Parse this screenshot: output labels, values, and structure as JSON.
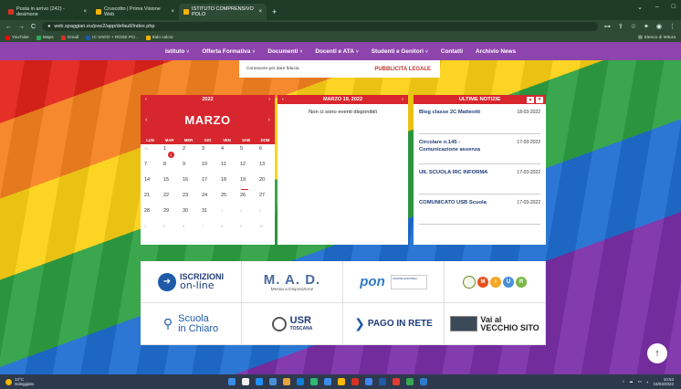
{
  "browser": {
    "tabs": [
      {
        "label": "Posta in arrivo (242) - desimone",
        "color": "#d93025"
      },
      {
        "label": "Cruscotto | Prima Visione Web",
        "color": "#f4b400"
      },
      {
        "label": "ISTITUTO COMPRENSIVO POLO",
        "color": "#f4b400"
      }
    ],
    "new_tab": "+",
    "url": "web.spaggiari.eu/pvw2/app/default/index.php",
    "bookmarks": [
      {
        "label": "YouTube",
        "color": "#ff0000"
      },
      {
        "label": "Maps",
        "color": "#34a853"
      },
      {
        "label": "Gmail",
        "color": "#d93025"
      },
      {
        "label": "IC VADO + ROSE PO...",
        "color": "#1e5aa8"
      },
      {
        "label": "Italo calcio",
        "color": "#f4b400"
      }
    ],
    "bookmarks_right": "Elenco di lettura"
  },
  "nav": {
    "items": [
      {
        "label": "Istituto",
        "caret": true
      },
      {
        "label": "Offerta Formativa",
        "caret": true
      },
      {
        "label": "Documenti",
        "caret": true
      },
      {
        "label": "Docenti e ATA",
        "caret": true
      },
      {
        "label": "Studenti e Genitori",
        "caret": true
      },
      {
        "label": "Contatti",
        "caret": false
      },
      {
        "label": "Archivio News",
        "caret": false
      }
    ]
  },
  "banner": {
    "left_text": "Conoscere per dare fiducia",
    "right_text": "PUBBLICITA LEGALE"
  },
  "calendar": {
    "year": "2022",
    "month": "MARZO",
    "weekdays": [
      "LUN",
      "MAR",
      "MER",
      "GIO",
      "VEN",
      "SAB",
      "DOM"
    ],
    "event_day_badge": "1",
    "rows": [
      [
        "28",
        "1",
        "2",
        "3",
        "4",
        "5",
        "6"
      ],
      [
        "7",
        "8",
        "9",
        "10",
        "11",
        "12",
        "13"
      ],
      [
        "14",
        "15",
        "16",
        "17",
        "18",
        "19",
        "20"
      ],
      [
        "21",
        "22",
        "23",
        "24",
        "25",
        "26",
        "27"
      ],
      [
        "28",
        "29",
        "30",
        "31",
        "1",
        "2",
        "3"
      ],
      [
        "4",
        "5",
        "6",
        "7",
        "8",
        "9",
        "10"
      ]
    ]
  },
  "events": {
    "header": "MARZO 19, 2022",
    "message": "Non ci sono eventi disponibili"
  },
  "news": {
    "header": "ULTIME NOTIZIE",
    "up": "▲",
    "down": "▼",
    "items": [
      {
        "title": "Blog classe 2C Matteotti",
        "date": "18-03-2022"
      },
      {
        "title": "Circolare n.145 - Comunicazione assenza",
        "date": "17-03-2022"
      },
      {
        "title": "UIL SCUOLA IRC INFORMA",
        "date": "17-03-2022"
      },
      {
        "title": "COMUNICATO USB Scuola",
        "date": "17-03-2022"
      }
    ]
  },
  "links": {
    "iscrizioni": {
      "line1": "ISCRIZIONI",
      "line2": "on-line"
    },
    "mad": {
      "title": "M. A. D.",
      "subtitle": "Messa a Disposizione"
    },
    "pon": {
      "logo": "pon",
      "eu_text": "UNIONE EUROPEA"
    },
    "miur": {
      "letters": [
        "M",
        "I",
        "U",
        "R"
      ],
      "colors": [
        "#e84e1b",
        "#f5a623",
        "#4a90d9",
        "#7ab648"
      ]
    },
    "scuola": {
      "line1": "Scuola",
      "line2": "in Chiaro"
    },
    "usr": {
      "title": "USR",
      "subtitle": "TOSCANA"
    },
    "pago": {
      "label": "PAGO IN RETE"
    },
    "vecchio": {
      "line1": "Vai al",
      "line2": "VECCHIO SITO"
    }
  },
  "to_top": "↑",
  "taskbar": {
    "weather_temp": "12°C",
    "weather_desc": "Soleggiato",
    "time": "10:53",
    "date": "19/03/2022",
    "icons": [
      "#3b8ee8",
      "#f0f0f0",
      "#1e90ff",
      "#4a90d9",
      "#e8a33d",
      "#0f7dd8",
      "#2eb872",
      "#3b8ee8",
      "#ffb900",
      "#d93025",
      "#4285f4",
      "#1e5aa8",
      "#e53935",
      "#34a853",
      "#2d7bc8"
    ]
  }
}
